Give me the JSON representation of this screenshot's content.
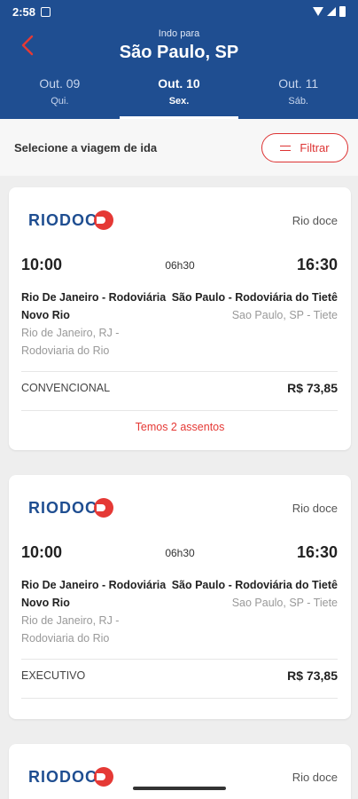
{
  "status_bar": {
    "time": "2:58"
  },
  "header": {
    "subtitle": "Indo para",
    "title": "São Paulo, SP",
    "tabs": [
      {
        "date": "Out. 09",
        "weekday": "Qui."
      },
      {
        "date": "Out. 10",
        "weekday": "Sex."
      },
      {
        "date": "Out. 11",
        "weekday": "Sáb."
      }
    ],
    "active_tab_index": 1
  },
  "toolbar": {
    "label": "Selecione a viagem de ida",
    "filter_label": "Filtrar"
  },
  "logo_text": "RIODOC",
  "trips": [
    {
      "company": "Rio doce",
      "departure_time": "10:00",
      "duration": "06h30",
      "arrival_time": "16:30",
      "origin_station": "Rio De Janeiro - Rodoviária Novo Rio",
      "origin_city": "Rio de Janeiro, RJ - Rodoviaria do Rio",
      "dest_station": "São Paulo - Rodoviária do Tietê",
      "dest_city": "Sao Paulo, SP - Tiete",
      "class": "CONVENCIONAL",
      "price": "R$ 73,85",
      "seats": "Temos 2 assentos"
    },
    {
      "company": "Rio doce",
      "departure_time": "10:00",
      "duration": "06h30",
      "arrival_time": "16:30",
      "origin_station": "Rio De Janeiro - Rodoviária Novo Rio",
      "origin_city": "Rio de Janeiro, RJ - Rodoviaria do Rio",
      "dest_station": "São Paulo - Rodoviária do Tietê",
      "dest_city": "Sao Paulo, SP - Tiete",
      "class": "EXECUTIVO",
      "price": "R$ 73,85"
    },
    {
      "company": "Rio doce"
    }
  ],
  "colors": {
    "brand": "#1f4e91",
    "accent": "#e53935"
  }
}
